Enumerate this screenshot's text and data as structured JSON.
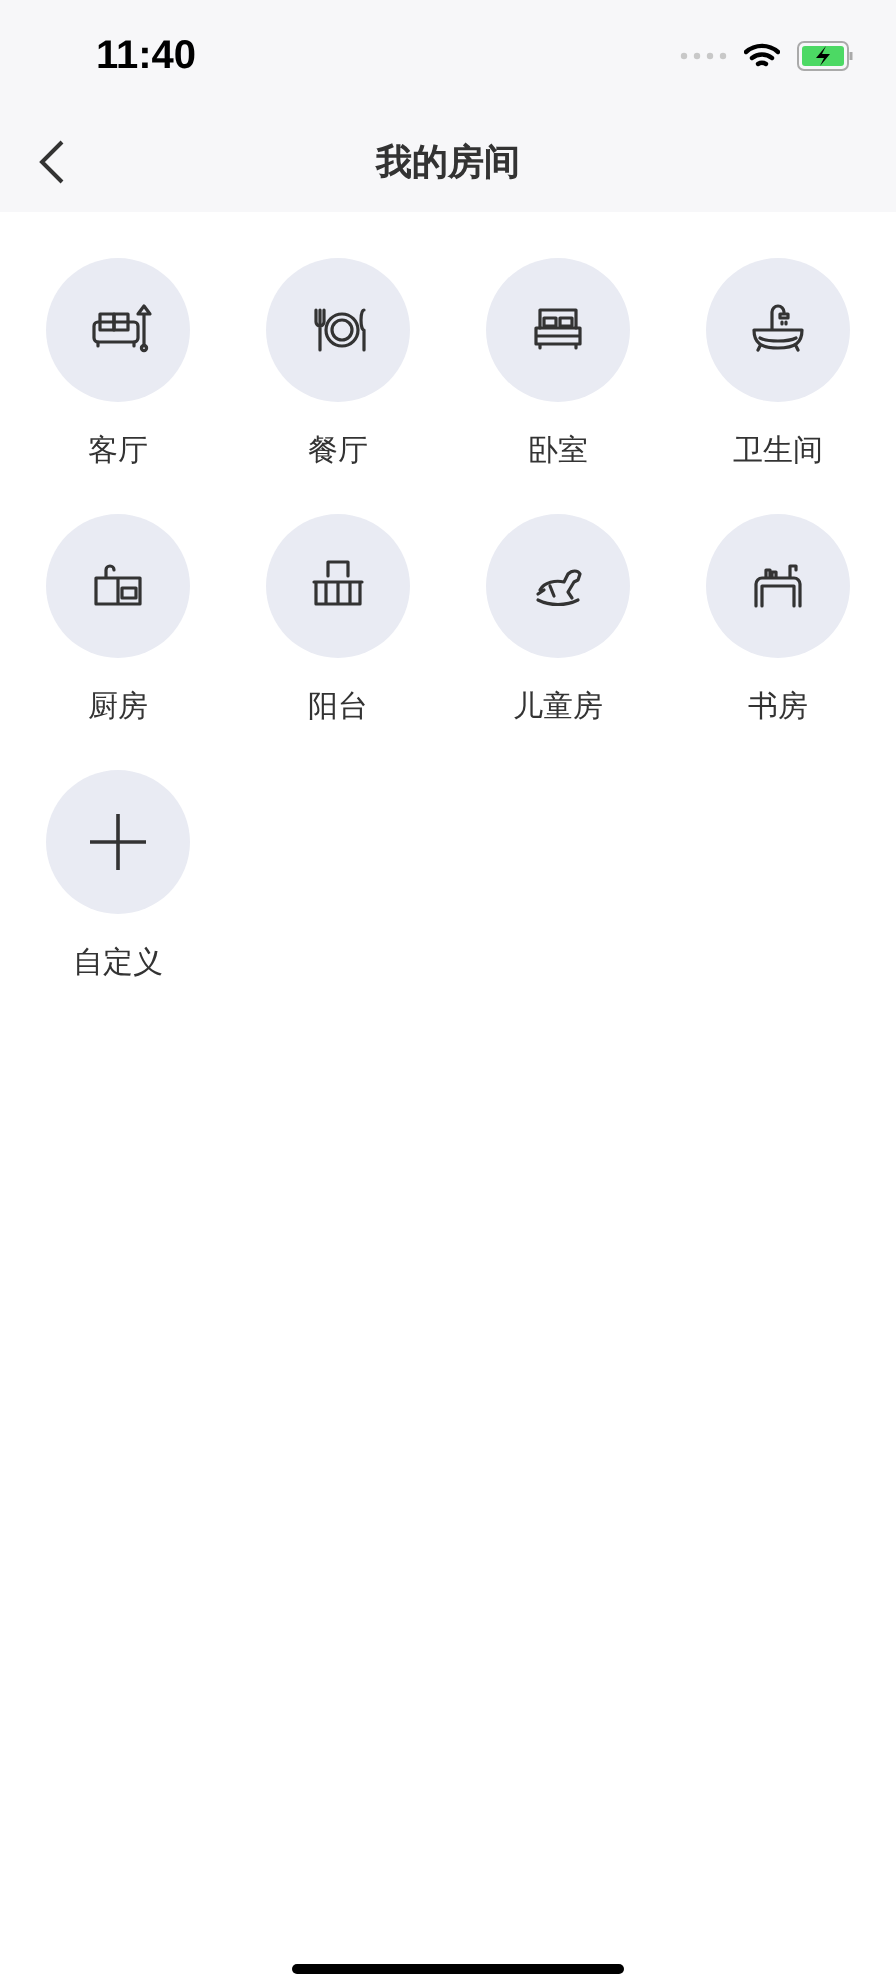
{
  "status_bar": {
    "time": "11:40"
  },
  "nav": {
    "title": "我的房间"
  },
  "rooms": [
    {
      "kind": "room",
      "label": "客厅"
    },
    {
      "kind": "room",
      "label": "餐厅"
    },
    {
      "kind": "room",
      "label": "卧室"
    },
    {
      "kind": "room",
      "label": "卫生间"
    },
    {
      "kind": "room",
      "label": "厨房"
    },
    {
      "kind": "room",
      "label": "阳台"
    },
    {
      "kind": "room",
      "label": "儿童房"
    },
    {
      "kind": "room",
      "label": "书房"
    },
    {
      "kind": "add",
      "label": "自定义"
    }
  ]
}
